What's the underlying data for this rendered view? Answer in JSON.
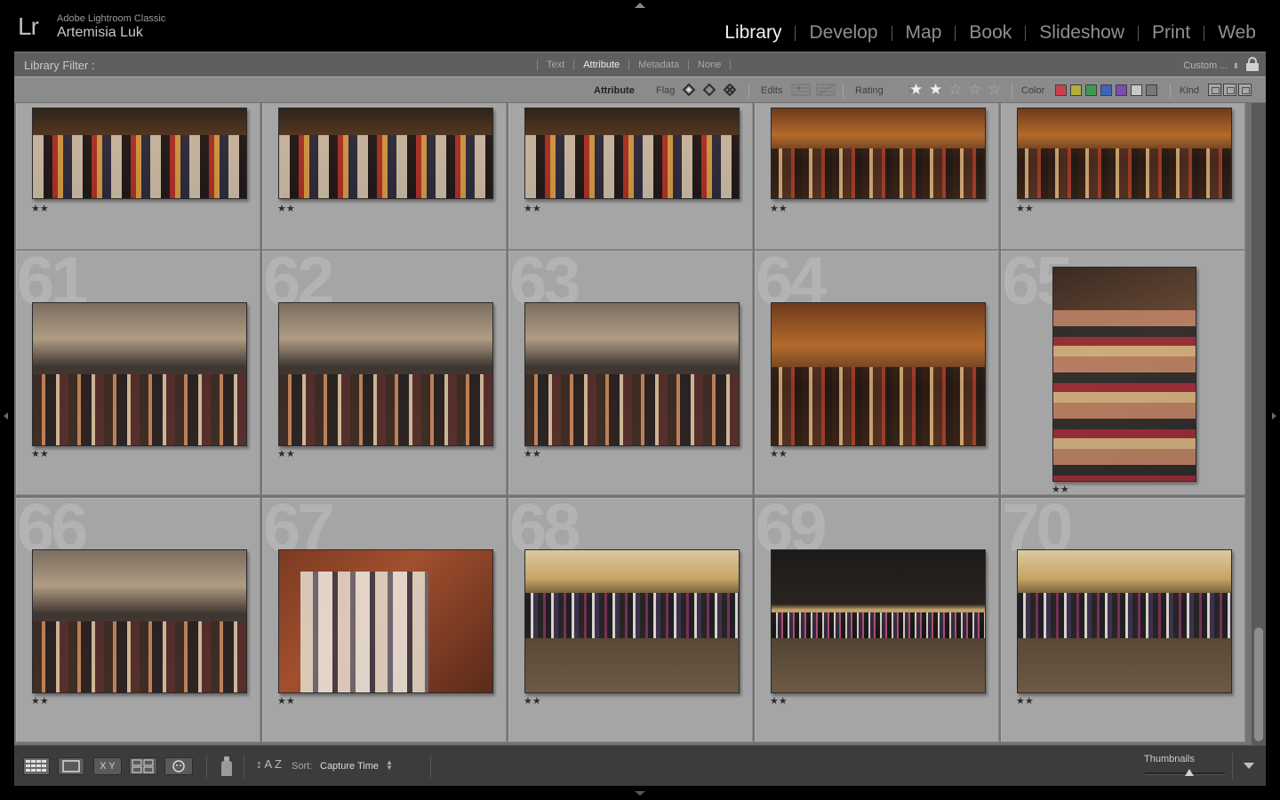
{
  "identity": {
    "app_name": "Adobe Lightroom Classic",
    "user_name": "Artemisia Luk",
    "logo": "Lr"
  },
  "modules": [
    {
      "label": "Library",
      "active": true
    },
    {
      "label": "Develop",
      "active": false
    },
    {
      "label": "Map",
      "active": false
    },
    {
      "label": "Book",
      "active": false
    },
    {
      "label": "Slideshow",
      "active": false
    },
    {
      "label": "Print",
      "active": false
    },
    {
      "label": "Web",
      "active": false
    }
  ],
  "filter_bar": {
    "title": "Library Filter :",
    "tabs": [
      {
        "label": "Text",
        "active": false
      },
      {
        "label": "Attribute",
        "active": true
      },
      {
        "label": "Metadata",
        "active": false
      },
      {
        "label": "None",
        "active": false
      }
    ],
    "preset": "Custom ...",
    "preset_chevron": "⬍",
    "lock_icon": "lock-icon"
  },
  "attribute_bar": {
    "label": "Attribute",
    "flag_label": "Flag",
    "edits_label": "Edits",
    "rating_label": "Rating",
    "rating_operator": "≥",
    "rating_filter_value": 2,
    "rating_max": 5,
    "star_on": "★",
    "star_off": "☆",
    "color_label": "Color",
    "colors": [
      "#c8404a",
      "#b3b03a",
      "#3c9a52",
      "#4062b8",
      "#7e4bb0",
      "#c8c8c8",
      "#777777"
    ],
    "kind_label": "Kind"
  },
  "grid": {
    "cells": [
      {
        "number": "",
        "rating": "★★",
        "style": "t-crowd"
      },
      {
        "number": "",
        "rating": "★★",
        "style": "t-crowd"
      },
      {
        "number": "",
        "rating": "★★",
        "style": "t-crowd"
      },
      {
        "number": "",
        "rating": "★★",
        "style": "t-warm"
      },
      {
        "number": "",
        "rating": "★★",
        "style": "t-warm"
      },
      {
        "number": "61",
        "rating": "★★",
        "style": "t-ceiling"
      },
      {
        "number": "62",
        "rating": "★★",
        "style": "t-ceiling"
      },
      {
        "number": "63",
        "rating": "★★",
        "style": "t-ceiling"
      },
      {
        "number": "64",
        "rating": "★★",
        "style": "t-warm"
      },
      {
        "number": "65",
        "rating": "★★",
        "style": "t-portrait"
      },
      {
        "number": "66",
        "rating": "★★",
        "style": "t-ceiling"
      },
      {
        "number": "67",
        "rating": "★★",
        "style": "t-brick"
      },
      {
        "number": "68",
        "rating": "★★",
        "style": "t-plaza"
      },
      {
        "number": "69",
        "rating": "★★",
        "style": "t-dark"
      },
      {
        "number": "70",
        "rating": "★★",
        "style": "t-plaza"
      }
    ]
  },
  "toolbar": {
    "view_buttons": [
      {
        "name": "grid-view-button",
        "label": ""
      },
      {
        "name": "loupe-view-button",
        "label": ""
      },
      {
        "name": "compare-view-button",
        "label": "X Y"
      },
      {
        "name": "survey-view-button",
        "label": ""
      },
      {
        "name": "people-view-button",
        "label": ""
      }
    ],
    "sort_icon": "↕ A Z",
    "sort_label": "Sort:",
    "sort_value": "Capture Time",
    "sort_chevron": "▲▼",
    "thumbnails_label": "Thumbnails",
    "thumbnail_size": 0.55
  }
}
